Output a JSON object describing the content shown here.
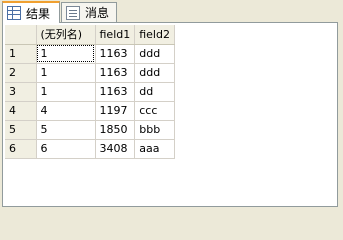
{
  "tabs": [
    {
      "label": "结果",
      "icon": "results-grid-icon",
      "active": true
    },
    {
      "label": "消息",
      "icon": "messages-icon",
      "active": false
    }
  ],
  "grid": {
    "columns": [
      "(无列名)",
      "field1",
      "field2"
    ],
    "rows": [
      {
        "num": "1",
        "cells": [
          "1",
          "1163",
          "ddd"
        ]
      },
      {
        "num": "2",
        "cells": [
          "1",
          "1163",
          "ddd"
        ]
      },
      {
        "num": "3",
        "cells": [
          "1",
          "1163",
          "dd"
        ]
      },
      {
        "num": "4",
        "cells": [
          "4",
          "1197",
          "ccc"
        ]
      },
      {
        "num": "5",
        "cells": [
          "5",
          "1850",
          "bbb"
        ]
      },
      {
        "num": "6",
        "cells": [
          "6",
          "3408",
          "aaa"
        ]
      }
    ]
  }
}
